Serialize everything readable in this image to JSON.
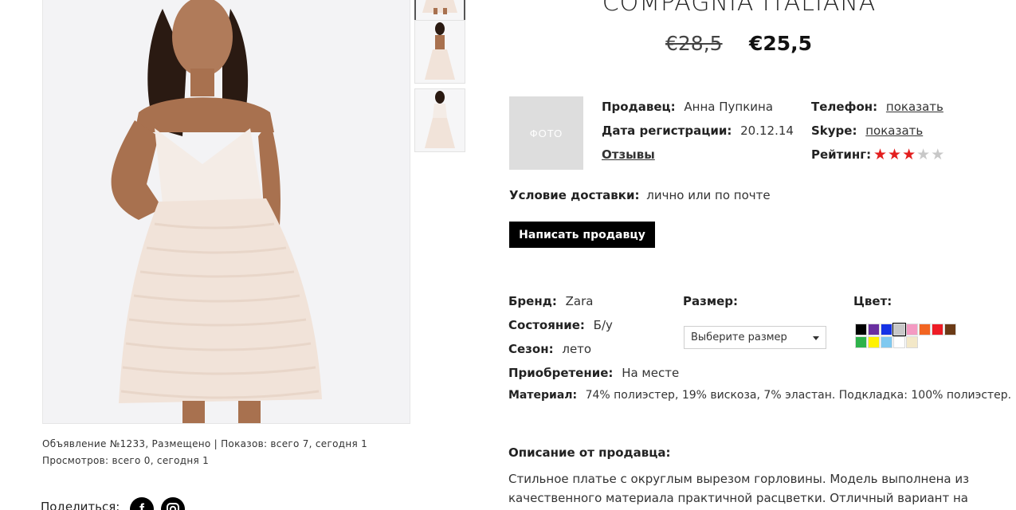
{
  "product": {
    "title": "COMPAGNIA ITALIANA",
    "old_price": "€28,5",
    "new_price": "€25,5"
  },
  "gallery": {
    "thumbnails": [
      "thumb-1",
      "thumb-2",
      "thumb-3"
    ]
  },
  "seller": {
    "photo_placeholder": "ФОТО",
    "seller_label": "Продавец:",
    "seller_name": "Анна Пупкина",
    "reg_label": "Дата регистрации:",
    "reg_date": "20.12.14",
    "reviews_link": "Отзывы",
    "phone_label": "Телефон:",
    "phone_link": "показать",
    "skype_label": "Skype:",
    "skype_link": "показать",
    "rating_label": "Рейтинг:",
    "rating": 3,
    "rating_max": 5
  },
  "delivery": {
    "label": "Условие доставки:",
    "value": "лично или по почте"
  },
  "write_button": "Написать продавцу",
  "details": {
    "brand_label": "Бренд:",
    "brand": "Zara",
    "condition_label": "Состояние:",
    "condition": "Б/у",
    "season_label": "Сезон:",
    "season": "лето",
    "purchase_label": "Приобретение:",
    "purchase": "На месте",
    "material_label": "Материал:",
    "material": "74% полиэстер, 19% вискоза, 7% эластан. Подкладка: 100% полиэстер."
  },
  "size": {
    "label": "Размер:",
    "selected": "Выберите размер"
  },
  "color": {
    "label": "Цвет:",
    "swatches": [
      "#000000",
      "#6a2fa0",
      "#1533e6",
      "#c8c8c8",
      "#f49ac2",
      "#f26522",
      "#ee1c25",
      "#6b3a16",
      "#2eb24a",
      "#fff200",
      "#7fc9f0",
      "#ffffff",
      "#f3e8c8"
    ],
    "selected_index": 3
  },
  "listing_meta": {
    "line1": "Объявление №1233, Размещено |  Показов: всего 7, сегодня 1",
    "line2": "Просмотров: всего 0, сегодня 1"
  },
  "share": {
    "label": "Поделиться:"
  },
  "description": {
    "title": "Описание от продавца:",
    "text": "Стильное платье с округлым вырезом горловины. Модель выполнена из качественного материала практичной расцветки. Отличный вариант на"
  }
}
